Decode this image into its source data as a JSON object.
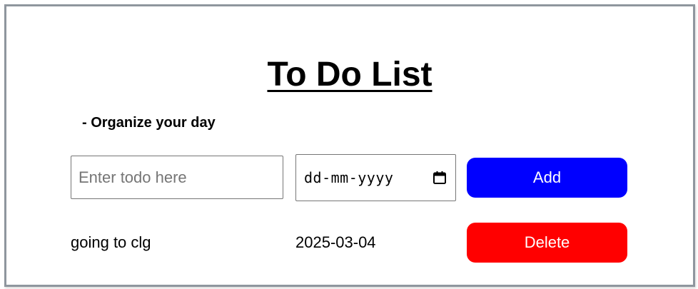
{
  "header": {
    "title": "To Do List",
    "subtitle": "- Organize your day"
  },
  "form": {
    "todo_placeholder": "Enter todo here",
    "todo_value": "",
    "date_placeholder": "dd-mm-yyyy",
    "add_label": "Add",
    "add_color": "#0000ff"
  },
  "todos": [
    {
      "name": "going to clg",
      "due_date": "2025-03-04",
      "delete_label": "Delete",
      "delete_color": "#ff0000"
    }
  ],
  "icons": {
    "date_picker": "calendar-icon"
  }
}
